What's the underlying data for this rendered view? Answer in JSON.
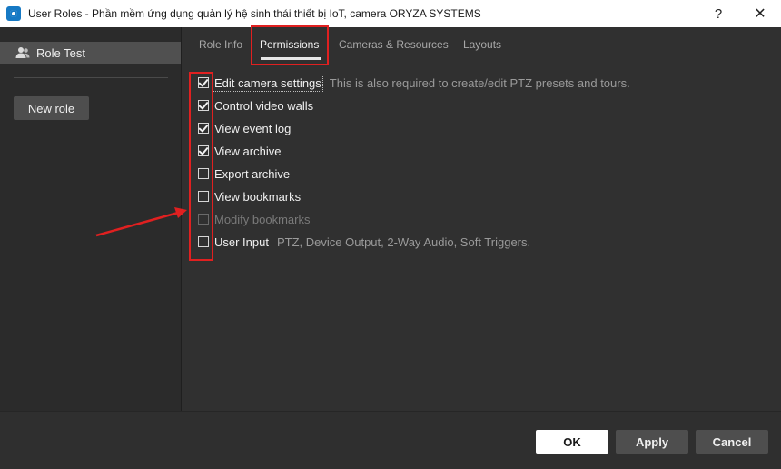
{
  "window": {
    "title": "User Roles - Phần mềm ứng dụng quản lý hệ sinh thái thiết bị IoT, camera ORYZA SYSTEMS",
    "help_label": "?",
    "close_label": "✕"
  },
  "sidebar": {
    "roles": [
      {
        "label": "Role Test"
      }
    ],
    "new_role_label": "New role"
  },
  "tabs": [
    {
      "label": "Role Info",
      "active": false
    },
    {
      "label": "Permissions",
      "active": true
    },
    {
      "label": "Cameras & Resources",
      "active": false
    },
    {
      "label": "Layouts",
      "active": false
    }
  ],
  "permissions": [
    {
      "label": "Edit camera settings",
      "checked": true,
      "enabled": true,
      "description": "This is also required to create/edit PTZ presets and tours."
    },
    {
      "label": "Control video walls",
      "checked": true,
      "enabled": true,
      "description": ""
    },
    {
      "label": "View event log",
      "checked": true,
      "enabled": true,
      "description": ""
    },
    {
      "label": "View archive",
      "checked": true,
      "enabled": true,
      "description": ""
    },
    {
      "label": "Export archive",
      "checked": false,
      "enabled": true,
      "description": ""
    },
    {
      "label": "View bookmarks",
      "checked": false,
      "enabled": true,
      "description": ""
    },
    {
      "label": "Modify bookmarks",
      "checked": false,
      "enabled": false,
      "description": ""
    },
    {
      "label": "User Input",
      "checked": false,
      "enabled": true,
      "description": "PTZ, Device Output, 2-Way Audio, Soft Triggers."
    }
  ],
  "footer": {
    "ok_label": "OK",
    "apply_label": "Apply",
    "cancel_label": "Cancel"
  },
  "colors": {
    "annotation": "#e02020",
    "background": "#303030",
    "sidebar": "#2b2b2b"
  }
}
